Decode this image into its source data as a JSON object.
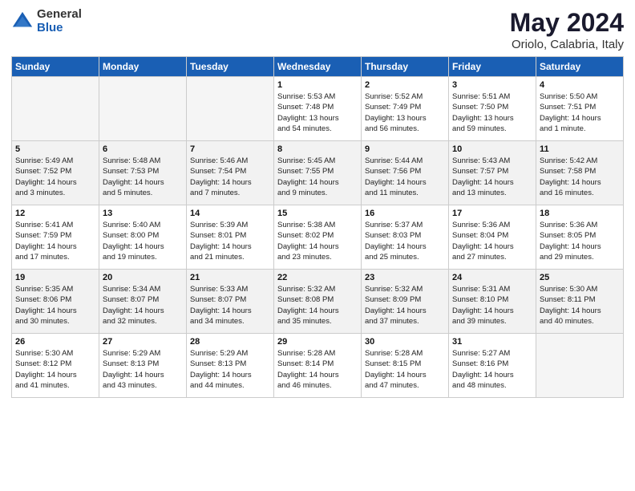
{
  "header": {
    "logo_general": "General",
    "logo_blue": "Blue",
    "main_title": "May 2024",
    "subtitle": "Oriolo, Calabria, Italy"
  },
  "days_of_week": [
    "Sunday",
    "Monday",
    "Tuesday",
    "Wednesday",
    "Thursday",
    "Friday",
    "Saturday"
  ],
  "weeks": [
    [
      {
        "day": "",
        "info": ""
      },
      {
        "day": "",
        "info": ""
      },
      {
        "day": "",
        "info": ""
      },
      {
        "day": "1",
        "info": "Sunrise: 5:53 AM\nSunset: 7:48 PM\nDaylight: 13 hours\nand 54 minutes."
      },
      {
        "day": "2",
        "info": "Sunrise: 5:52 AM\nSunset: 7:49 PM\nDaylight: 13 hours\nand 56 minutes."
      },
      {
        "day": "3",
        "info": "Sunrise: 5:51 AM\nSunset: 7:50 PM\nDaylight: 13 hours\nand 59 minutes."
      },
      {
        "day": "4",
        "info": "Sunrise: 5:50 AM\nSunset: 7:51 PM\nDaylight: 14 hours\nand 1 minute."
      }
    ],
    [
      {
        "day": "5",
        "info": "Sunrise: 5:49 AM\nSunset: 7:52 PM\nDaylight: 14 hours\nand 3 minutes."
      },
      {
        "day": "6",
        "info": "Sunrise: 5:48 AM\nSunset: 7:53 PM\nDaylight: 14 hours\nand 5 minutes."
      },
      {
        "day": "7",
        "info": "Sunrise: 5:46 AM\nSunset: 7:54 PM\nDaylight: 14 hours\nand 7 minutes."
      },
      {
        "day": "8",
        "info": "Sunrise: 5:45 AM\nSunset: 7:55 PM\nDaylight: 14 hours\nand 9 minutes."
      },
      {
        "day": "9",
        "info": "Sunrise: 5:44 AM\nSunset: 7:56 PM\nDaylight: 14 hours\nand 11 minutes."
      },
      {
        "day": "10",
        "info": "Sunrise: 5:43 AM\nSunset: 7:57 PM\nDaylight: 14 hours\nand 13 minutes."
      },
      {
        "day": "11",
        "info": "Sunrise: 5:42 AM\nSunset: 7:58 PM\nDaylight: 14 hours\nand 16 minutes."
      }
    ],
    [
      {
        "day": "12",
        "info": "Sunrise: 5:41 AM\nSunset: 7:59 PM\nDaylight: 14 hours\nand 17 minutes."
      },
      {
        "day": "13",
        "info": "Sunrise: 5:40 AM\nSunset: 8:00 PM\nDaylight: 14 hours\nand 19 minutes."
      },
      {
        "day": "14",
        "info": "Sunrise: 5:39 AM\nSunset: 8:01 PM\nDaylight: 14 hours\nand 21 minutes."
      },
      {
        "day": "15",
        "info": "Sunrise: 5:38 AM\nSunset: 8:02 PM\nDaylight: 14 hours\nand 23 minutes."
      },
      {
        "day": "16",
        "info": "Sunrise: 5:37 AM\nSunset: 8:03 PM\nDaylight: 14 hours\nand 25 minutes."
      },
      {
        "day": "17",
        "info": "Sunrise: 5:36 AM\nSunset: 8:04 PM\nDaylight: 14 hours\nand 27 minutes."
      },
      {
        "day": "18",
        "info": "Sunrise: 5:36 AM\nSunset: 8:05 PM\nDaylight: 14 hours\nand 29 minutes."
      }
    ],
    [
      {
        "day": "19",
        "info": "Sunrise: 5:35 AM\nSunset: 8:06 PM\nDaylight: 14 hours\nand 30 minutes."
      },
      {
        "day": "20",
        "info": "Sunrise: 5:34 AM\nSunset: 8:07 PM\nDaylight: 14 hours\nand 32 minutes."
      },
      {
        "day": "21",
        "info": "Sunrise: 5:33 AM\nSunset: 8:07 PM\nDaylight: 14 hours\nand 34 minutes."
      },
      {
        "day": "22",
        "info": "Sunrise: 5:32 AM\nSunset: 8:08 PM\nDaylight: 14 hours\nand 35 minutes."
      },
      {
        "day": "23",
        "info": "Sunrise: 5:32 AM\nSunset: 8:09 PM\nDaylight: 14 hours\nand 37 minutes."
      },
      {
        "day": "24",
        "info": "Sunrise: 5:31 AM\nSunset: 8:10 PM\nDaylight: 14 hours\nand 39 minutes."
      },
      {
        "day": "25",
        "info": "Sunrise: 5:30 AM\nSunset: 8:11 PM\nDaylight: 14 hours\nand 40 minutes."
      }
    ],
    [
      {
        "day": "26",
        "info": "Sunrise: 5:30 AM\nSunset: 8:12 PM\nDaylight: 14 hours\nand 41 minutes."
      },
      {
        "day": "27",
        "info": "Sunrise: 5:29 AM\nSunset: 8:13 PM\nDaylight: 14 hours\nand 43 minutes."
      },
      {
        "day": "28",
        "info": "Sunrise: 5:29 AM\nSunset: 8:13 PM\nDaylight: 14 hours\nand 44 minutes."
      },
      {
        "day": "29",
        "info": "Sunrise: 5:28 AM\nSunset: 8:14 PM\nDaylight: 14 hours\nand 46 minutes."
      },
      {
        "day": "30",
        "info": "Sunrise: 5:28 AM\nSunset: 8:15 PM\nDaylight: 14 hours\nand 47 minutes."
      },
      {
        "day": "31",
        "info": "Sunrise: 5:27 AM\nSunset: 8:16 PM\nDaylight: 14 hours\nand 48 minutes."
      },
      {
        "day": "",
        "info": ""
      }
    ]
  ]
}
